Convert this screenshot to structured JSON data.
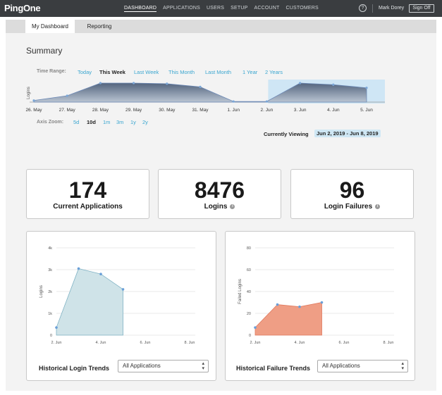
{
  "header": {
    "logo": "PingOne",
    "nav": [
      "DASHBOARD",
      "APPLICATIONS",
      "USERS",
      "SETUP",
      "ACCOUNT",
      "CUSTOMERS"
    ],
    "help_icon": "?",
    "user": "Mark Dorey",
    "signoff": "Sign Off"
  },
  "tabs": [
    "My Dashboard",
    "Reporting"
  ],
  "summary": {
    "title": "Summary",
    "time_range_label": "Time Range:",
    "time_ranges": [
      "Today",
      "This Week",
      "Last Week",
      "This Month",
      "Last Month",
      "1 Year",
      "2 Years"
    ],
    "active_time_range": "This Week",
    "axis_zoom_label": "Axis Zoom:",
    "zooms": [
      "5d",
      "10d",
      "1m",
      "3m",
      "1y",
      "2y"
    ],
    "active_zoom": "10d",
    "viewing_label": "Currently Viewing",
    "viewing_value": "Jun 2, 2019 - Jun 8, 2019"
  },
  "stats": {
    "applications": {
      "value": "174",
      "label": "Current Applications"
    },
    "logins": {
      "value": "8476",
      "label": "Logins"
    },
    "failures": {
      "value": "96",
      "label": "Login Failures"
    }
  },
  "login_chart": {
    "title": "Historical Login Trends",
    "select": "All Applications"
  },
  "failure_chart": {
    "title": "Historical Failure Trends",
    "select": "All Applications"
  },
  "colors": {
    "link": "#3aa6d0",
    "topbar": "#3a3d40",
    "login_fill": "#cfe3e8",
    "failure_fill": "#ef9e85"
  },
  "chart_data": [
    {
      "type": "area",
      "ylabel": "Logins",
      "categories": [
        "26. May",
        "27. May",
        "28. May",
        "29. May",
        "30. May",
        "31. May",
        "1. Jun",
        "2. Jun",
        "3. Jun",
        "4. Jun",
        "5. Jun"
      ],
      "values": [
        5,
        20,
        60,
        60,
        58,
        48,
        2,
        2,
        60,
        55,
        45
      ],
      "selected_range": [
        "2. Jun",
        "5. Jun"
      ]
    },
    {
      "type": "area",
      "ylabel": "Logins",
      "x_ticks": [
        "2. Jun",
        "4. Jun",
        "6. Jun",
        "8. Jun"
      ],
      "y_ticks": [
        "0",
        "1k",
        "2k",
        "3k",
        "4k"
      ],
      "ylim": [
        0,
        4000
      ],
      "x": [
        2,
        3,
        4,
        5
      ],
      "values": [
        350,
        3050,
        2800,
        2100
      ]
    },
    {
      "type": "area",
      "ylabel": "Failed Logins",
      "x_ticks": [
        "2. Jun",
        "4. Jun",
        "6. Jun",
        "8. Jun"
      ],
      "y_ticks": [
        "0",
        "20",
        "40",
        "60",
        "80"
      ],
      "ylim": [
        0,
        80
      ],
      "x": [
        2,
        3,
        4,
        5
      ],
      "values": [
        7,
        28,
        26,
        30
      ]
    }
  ]
}
